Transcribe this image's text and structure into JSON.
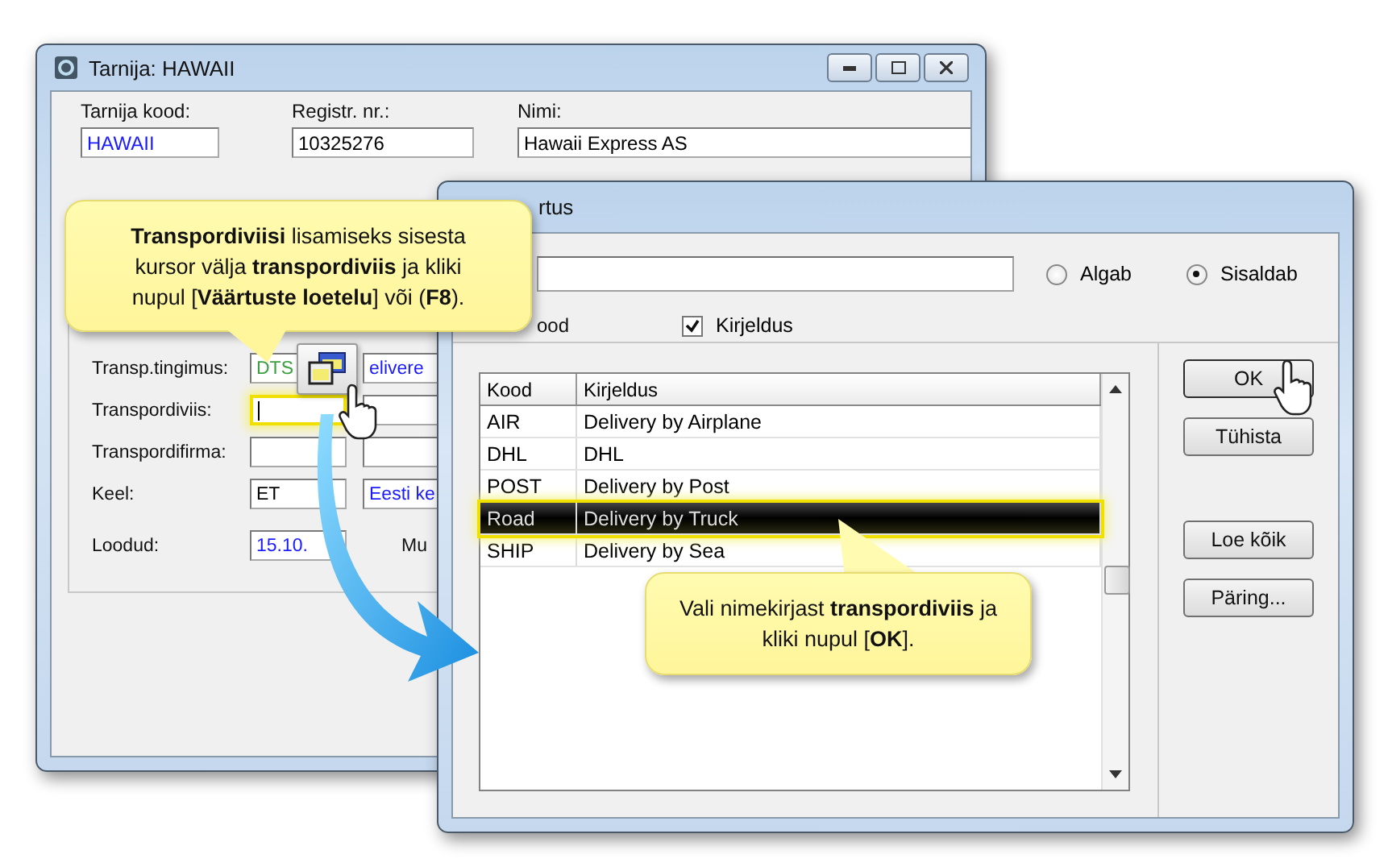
{
  "supplier_window": {
    "title": "Tarnija: HAWAII",
    "header_fields": [
      {
        "label": "Tarnija kood:",
        "value": "HAWAII",
        "color": "#1a1aff"
      },
      {
        "label": "Registr. nr.:",
        "value": "10325276",
        "color": "#000000"
      },
      {
        "label": "Nimi:",
        "value": "Hawaii Express AS",
        "color": "#000000"
      }
    ],
    "detail_rows": [
      {
        "label": "Transp.tingimus:",
        "fields": [
          {
            "value": "DTS",
            "color": "#3aa040",
            "focused": false
          },
          {
            "value": "elivere",
            "color": "#1a1aff",
            "focused": false
          }
        ]
      },
      {
        "label": "Transpordiviis:",
        "fields": [
          {
            "focused": true
          },
          {
            "focused": false
          }
        ]
      },
      {
        "label": "Transpordifirma:",
        "fields": [
          {
            "focused": false
          },
          {
            "focused": false
          }
        ]
      },
      {
        "label": "Keel:",
        "fields": [
          {
            "value": "ET",
            "color": "#000000",
            "focused": false
          },
          {
            "value": "Eesti ke",
            "color": "#1a1aff",
            "focused": false
          }
        ]
      },
      {
        "label": "Loodud:",
        "fields": [
          {
            "value": "15.10.",
            "color": "#1a1aff",
            "focused": false
          }
        ],
        "trailing_label": "Mu"
      }
    ]
  },
  "value_dialog": {
    "title": "rtus",
    "match_modes": [
      {
        "label": "Algab",
        "selected": false
      },
      {
        "label": "Sisaldab",
        "selected": true
      }
    ],
    "search_in": [
      {
        "kind": "label",
        "label": "ood"
      },
      {
        "kind": "checkbox",
        "label": "Kirjeldus",
        "checked": true
      }
    ],
    "table": {
      "columns": [
        "Kood",
        "Kirjeldus"
      ],
      "rows": [
        {
          "cells": [
            "AIR",
            "Delivery by Airplane"
          ],
          "selected": false
        },
        {
          "cells": [
            "DHL",
            "DHL"
          ],
          "selected": false
        },
        {
          "cells": [
            "POST",
            "Delivery by Post"
          ],
          "selected": false
        },
        {
          "cells": [
            "Road",
            "Delivery by Truck"
          ],
          "selected": true
        },
        {
          "cells": [
            "SHIP",
            "Delivery by Sea"
          ],
          "selected": false
        }
      ]
    },
    "buttons": [
      {
        "label": "OK",
        "default": true
      },
      {
        "label": "Tühista",
        "default": false
      },
      {
        "label": "Loe kõik",
        "default": false
      },
      {
        "label": "Päring...",
        "default": false
      }
    ]
  },
  "callouts": [
    "**Transpordiviisi**  lisamiseks sisesta kursor välja **transpordiviis** ja kliki nupul [**Väärtuste loetelu**] või (**F8**).",
    "Vali nimekirjast **transpordiviis** ja kliki nupul [**OK**]."
  ]
}
